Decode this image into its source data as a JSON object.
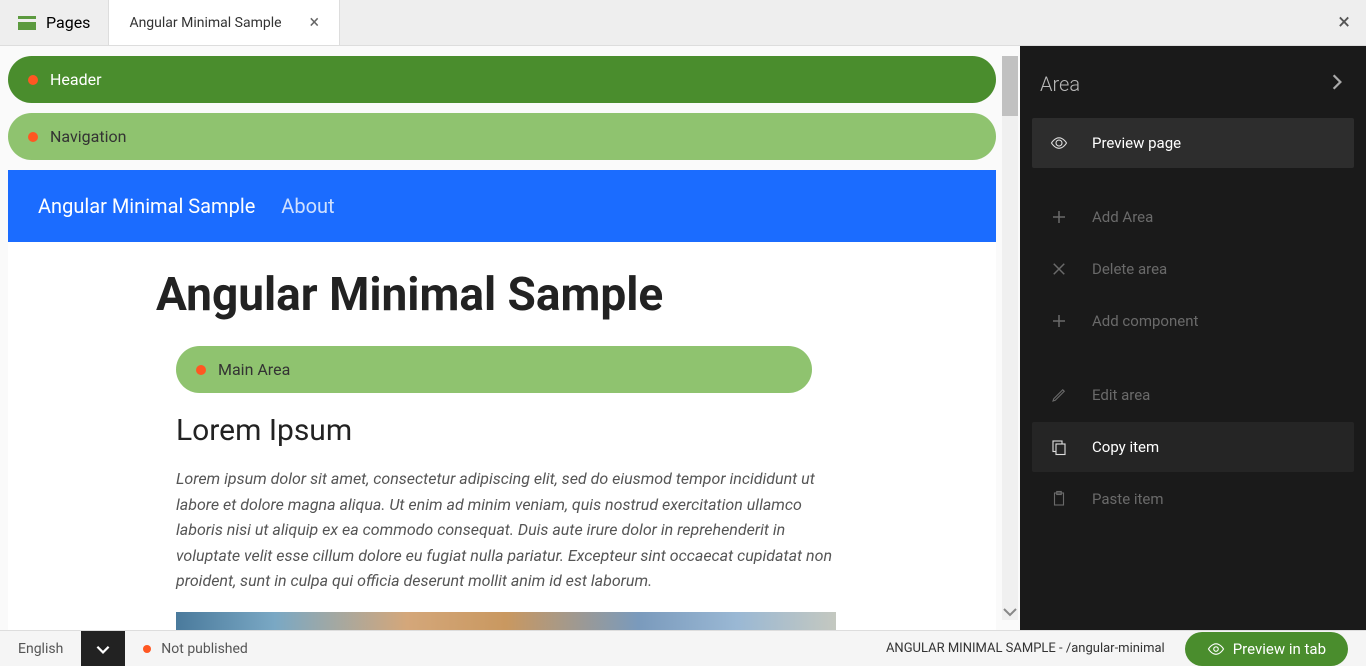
{
  "tabs": {
    "pages_label": "Pages",
    "active_tab": "Angular Minimal Sample"
  },
  "canvas": {
    "header_label": "Header",
    "nav_label": "Navigation",
    "nav_items": [
      "Angular Minimal Sample",
      "About"
    ],
    "page_title": "Angular Minimal Sample",
    "main_area_label": "Main Area",
    "subheading": "Lorem Ipsum",
    "paragraph": "Lorem ipsum dolor sit amet, consectetur adipiscing elit, sed do eiusmod tempor incididunt ut labore et dolore magna aliqua. Ut enim ad minim veniam, quis nostrud exercitation ullamco laboris nisi ut aliquip ex ea commodo consequat. Duis aute irure dolor in reprehenderit in voluptate velit esse cillum dolore eu fugiat nulla pariatur. Excepteur sint occaecat cupidatat non proident, sunt in culpa qui officia deserunt mollit anim id est laborum."
  },
  "sidebar": {
    "title": "Area",
    "preview_page": "Preview page",
    "add_area": "Add Area",
    "delete_area": "Delete area",
    "add_component": "Add component",
    "edit_area": "Edit area",
    "copy_item": "Copy item",
    "paste_item": "Paste item"
  },
  "bottom": {
    "language": "English",
    "status": "Not published",
    "path": "ANGULAR MINIMAL SAMPLE - /angular-minimal",
    "preview_btn": "Preview in tab"
  }
}
